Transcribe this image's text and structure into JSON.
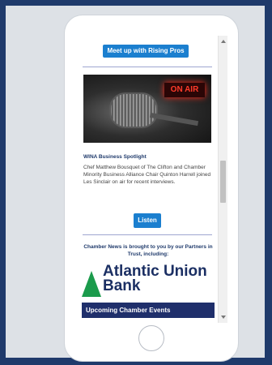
{
  "buttons": {
    "meetup": "Meet up with Rising Pros",
    "listen": "Listen"
  },
  "spotlight": {
    "image_sign": "ON AIR",
    "title": "WINA Business Spotlight",
    "body": "Chef Matthew Bousquet of The Clifton and Chamber Minority Business Alliance Chair Quinton Harrell joined Les Sinclair on air for recent interviews."
  },
  "sponsor": {
    "text": "Chamber News is brought to you by our Partners in Trust, including:",
    "bank_name": "Atlantic Union Bank"
  },
  "banner": {
    "events": "Upcoming Chamber Events"
  }
}
